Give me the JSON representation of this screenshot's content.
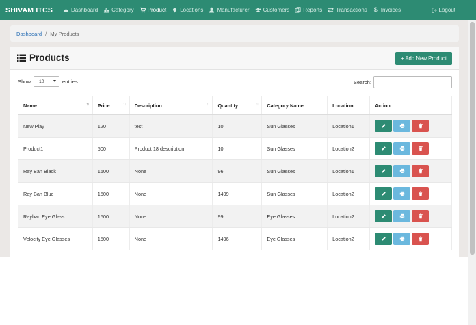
{
  "brand": "SHIVAM ITCS",
  "nav": [
    {
      "label": "Dashboard",
      "icon": "dashboard-icon"
    },
    {
      "label": "Category",
      "icon": "chart-icon"
    },
    {
      "label": "Product",
      "icon": "cart-icon",
      "active": true
    },
    {
      "label": "Locations",
      "icon": "map-marker-icon"
    },
    {
      "label": "Manufacturer",
      "icon": "user-icon"
    },
    {
      "label": "Customers",
      "icon": "users-icon"
    },
    {
      "label": "Reports",
      "icon": "copy-icon"
    },
    {
      "label": "Transactions",
      "icon": "exchange-icon"
    },
    {
      "label": "Invoices",
      "icon": "dollar-icon"
    }
  ],
  "logout_label": "Logout",
  "breadcrumb": {
    "home": "Dashboard",
    "separator": "/",
    "current": "My Products"
  },
  "page": {
    "title": "Products",
    "add_label": "+ Add New Product"
  },
  "controls": {
    "show_label": "Show",
    "entries_value": "10",
    "entries_label": "entries",
    "search_label": "Search:",
    "search_value": ""
  },
  "table": {
    "headers": [
      "Name",
      "Price",
      "Description",
      "Quantity",
      "Category Name",
      "Location",
      "Action"
    ],
    "rows": [
      [
        "New Play",
        "120",
        "test",
        "10",
        "Sun Glasses",
        "Location1"
      ],
      [
        "Product1",
        "500",
        "Product 18 description",
        "10",
        "Sun Glasses",
        "Location2"
      ],
      [
        "Ray Ban Black",
        "1500",
        "None",
        "96",
        "Sun Glasses",
        "Location1"
      ],
      [
        "Ray Ban Blue",
        "1500",
        "None",
        "1499",
        "Sun Glasses",
        "Location2"
      ],
      [
        "Rayban Eye Glass",
        "1500",
        "None",
        "99",
        "Eye Glasses",
        "Location2"
      ],
      [
        "Velocity Eye Glasses",
        "1500",
        "None",
        "1496",
        "Eye Glasses",
        "Location2"
      ]
    ]
  },
  "colors": {
    "primary": "#2d8b73",
    "info": "#6bb8de",
    "danger": "#d9534f"
  }
}
